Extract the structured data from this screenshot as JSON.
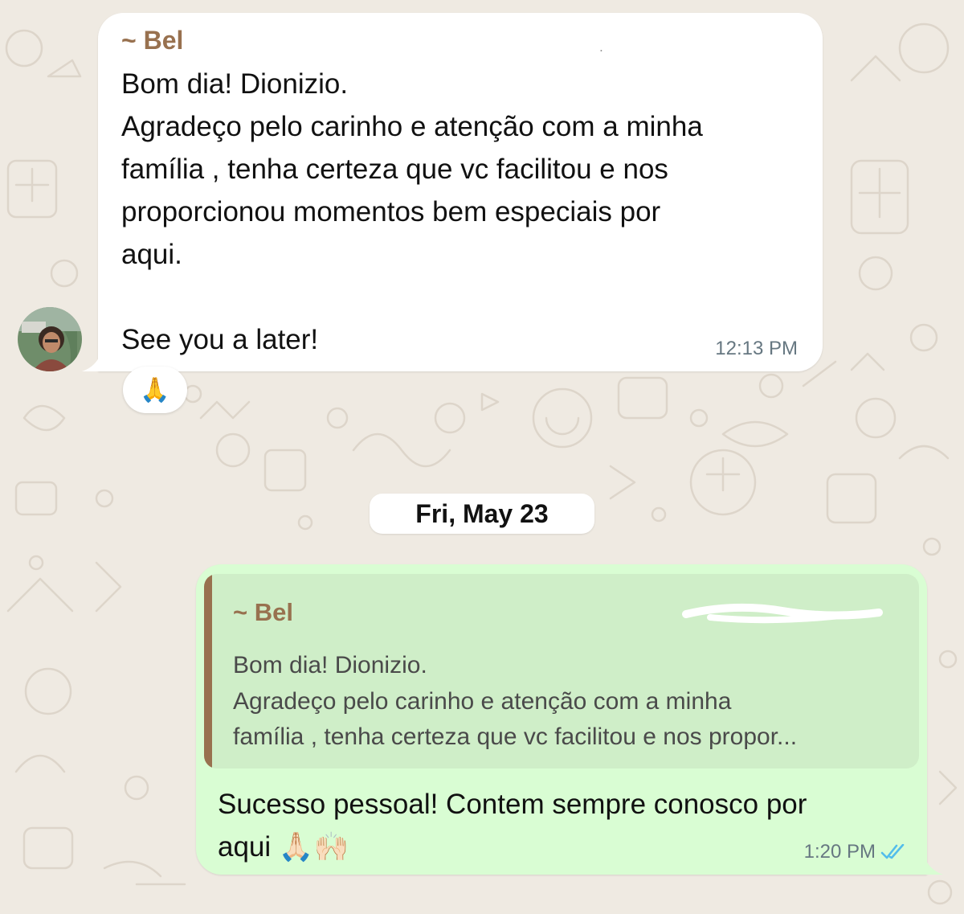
{
  "chat": {
    "incoming": {
      "sender": "~ Bel",
      "phone_partial": "+── ────── ────",
      "lines": [
        "Bom dia! Dionizio.",
        "Agradeço pelo carinho e atenção com a minha",
        "família , tenha certeza que vc facilitou e nos",
        "proporcionou momentos bem especiais por",
        "aqui.",
        "",
        "See you a later!"
      ],
      "time": "12:13 PM",
      "reaction": "🙏"
    },
    "date_separator": "Fri, May 23",
    "outgoing": {
      "quoted": {
        "sender": "~ Bel",
        "lines": [
          "Bom dia! Dionizio.",
          "Agradeço pelo carinho e atenção com a minha",
          "família , tenha certeza que vc facilitou e nos propor..."
        ]
      },
      "lines": [
        "Sucesso pessoal! Contem sempre conosco por",
        "aqui 🙏🏻🙌🏻"
      ],
      "time": "1:20 PM",
      "status_icon": "double-check-icon",
      "status_color": "#53bdeb"
    }
  },
  "colors": {
    "chat_background": "#efeae2",
    "incoming_bubble": "#ffffff",
    "outgoing_bubble": "#d9fdd3",
    "sender_name": "#98714f",
    "timestamp": "#667781"
  }
}
